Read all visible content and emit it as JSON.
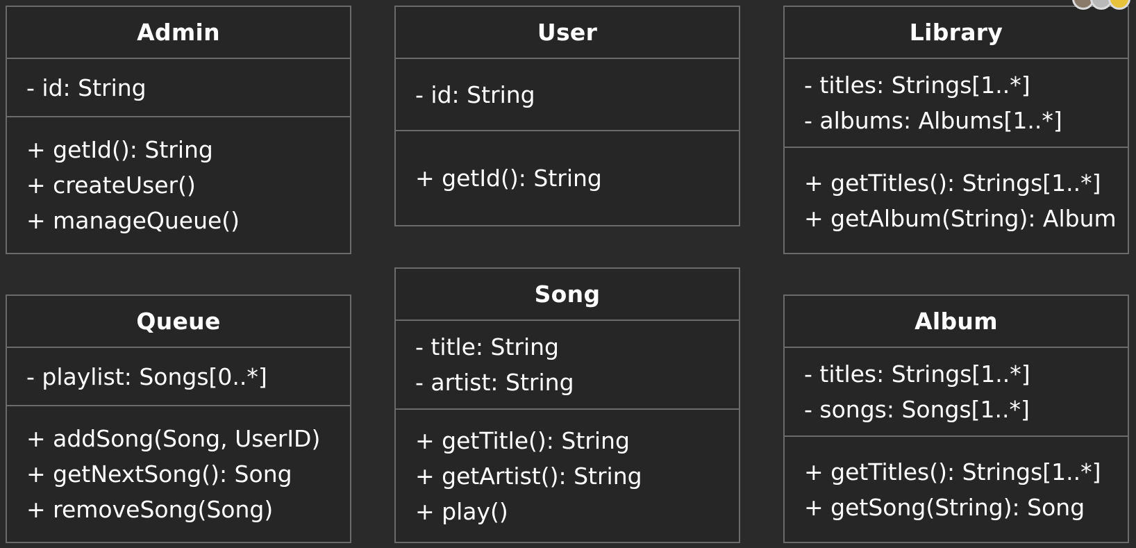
{
  "classes": {
    "admin": {
      "name": "Admin",
      "attributes": [
        "- id: String"
      ],
      "operations": [
        "+ getId(): String",
        "+ createUser()",
        "+ manageQueue()"
      ]
    },
    "user": {
      "name": "User",
      "attributes": [
        "- id: String"
      ],
      "operations": [
        "+ getId(): String"
      ]
    },
    "library": {
      "name": "Library",
      "attributes": [
        "- titles: Strings[1..*]",
        "- albums: Albums[1..*]"
      ],
      "operations": [
        "+ getTitles(): Strings[1..*]",
        "+ getAlbum(String): Album"
      ]
    },
    "queue": {
      "name": "Queue",
      "attributes": [
        "- playlist: Songs[0..*]"
      ],
      "operations": [
        "+ addSong(Song, UserID)",
        "+ getNextSong(): Song",
        "+ removeSong(Song)"
      ]
    },
    "song": {
      "name": "Song",
      "attributes": [
        "- title: String",
        "- artist: String"
      ],
      "operations": [
        "+ getTitle(): String",
        "+ getArtist(): String",
        "+ play()"
      ]
    },
    "album": {
      "name": "Album",
      "attributes": [
        "- titles: Strings[1..*]",
        "- songs: Songs[1..*]"
      ],
      "operations": [
        "+ getTitles(): Strings[1..*]",
        "+ getSong(String): Song"
      ]
    }
  },
  "colors": {
    "background": "#2a2a2a",
    "box_fill": "#262626",
    "border": "#6b6b6b",
    "text": "#ffffff"
  },
  "icons": [
    "avatar-icon",
    "avatar-icon",
    "avatar-icon"
  ]
}
